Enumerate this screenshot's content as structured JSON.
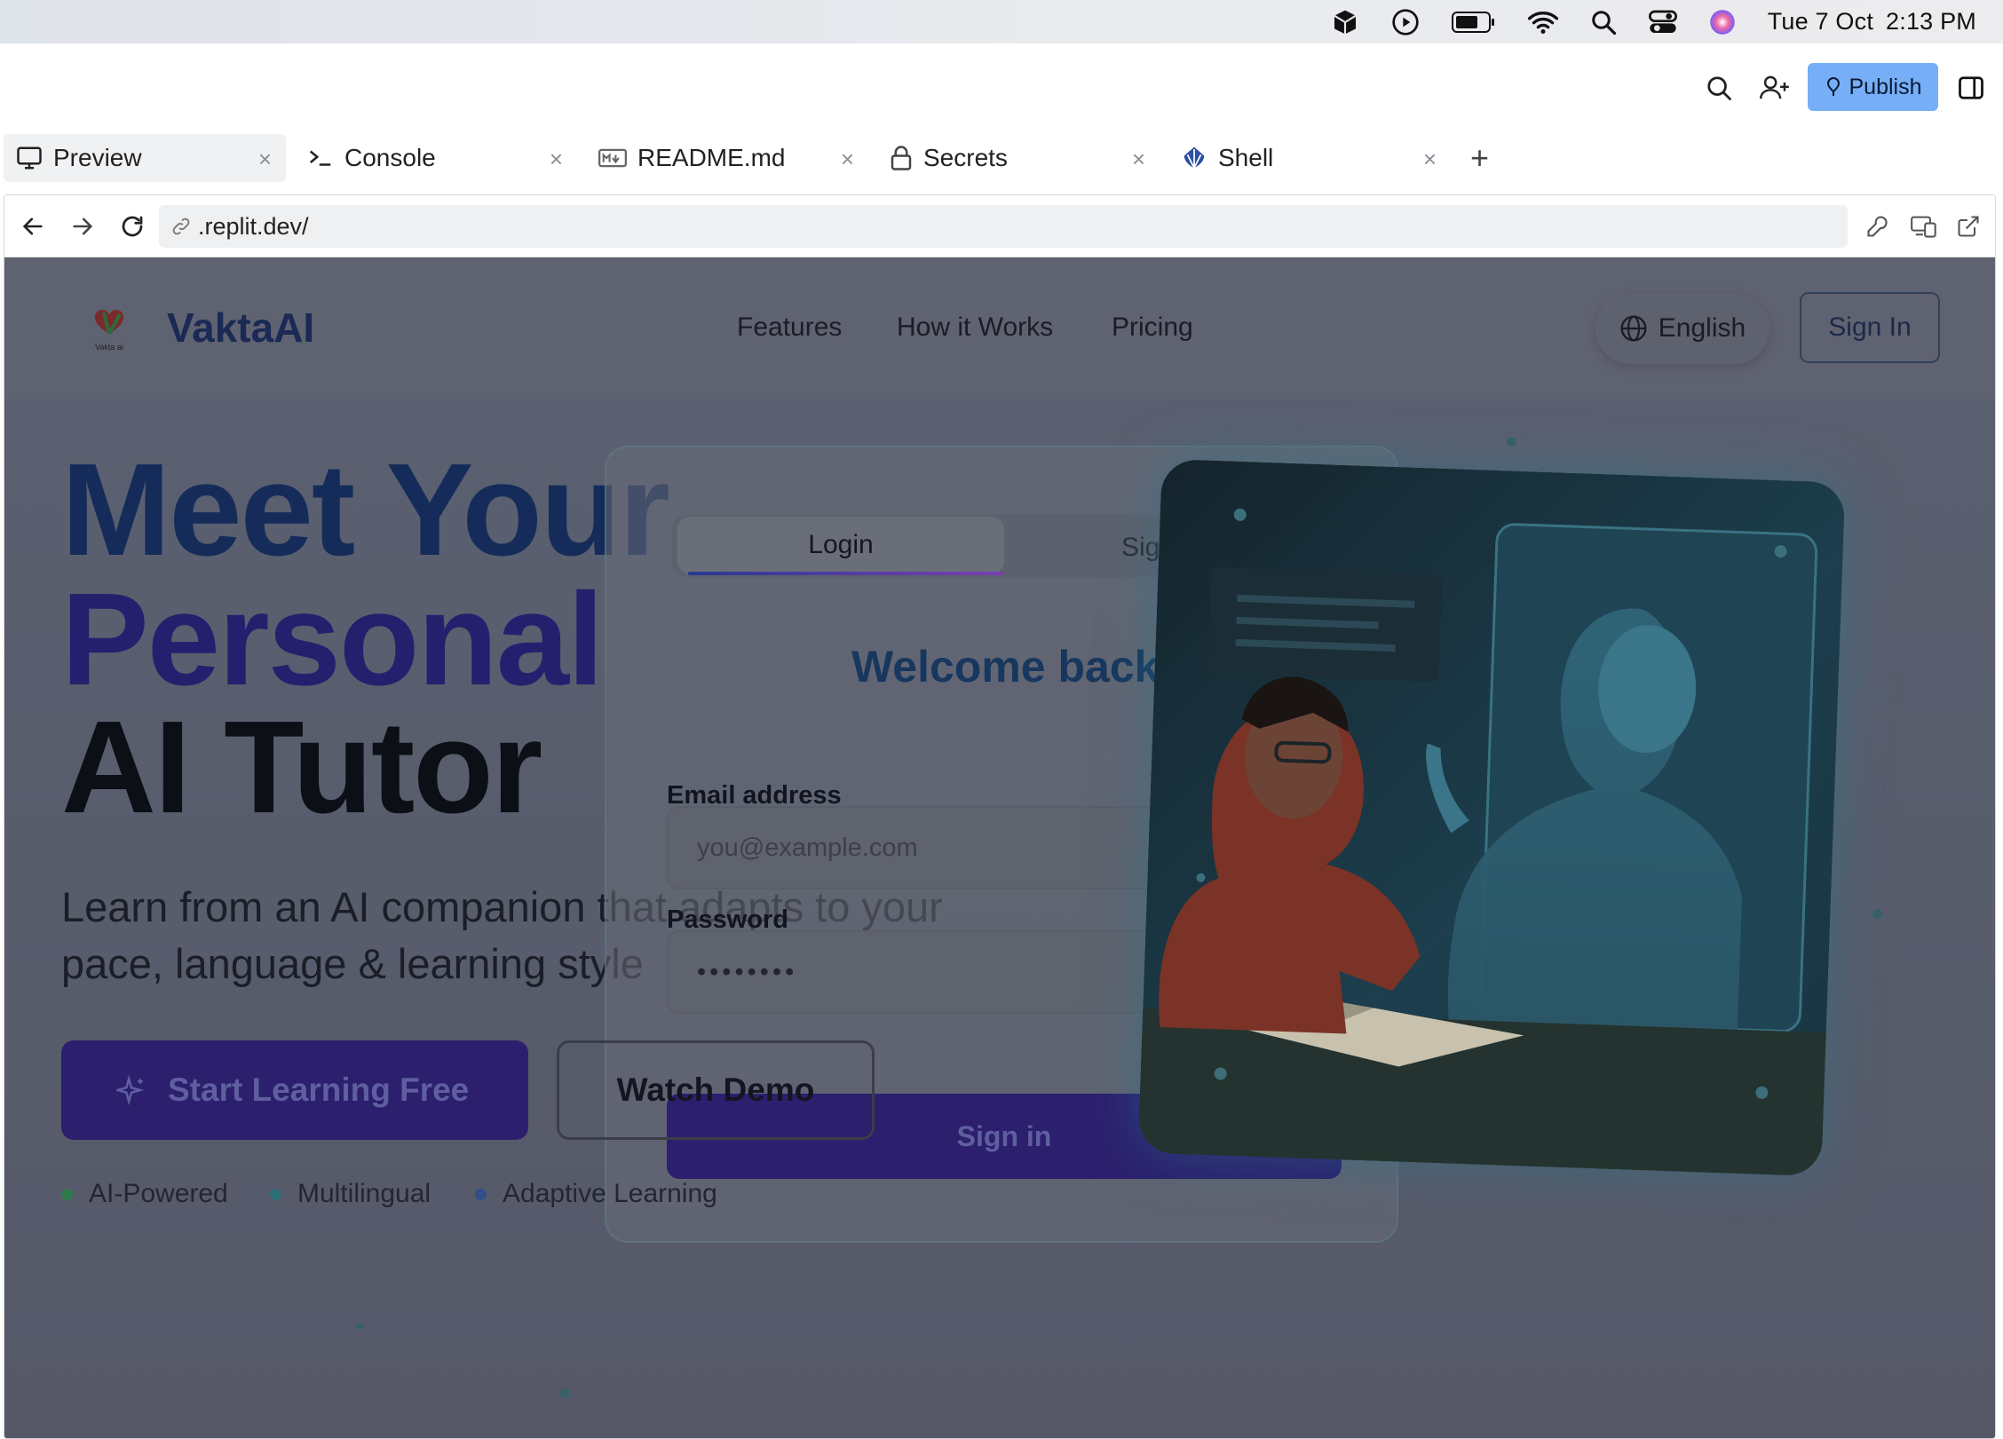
{
  "menubar": {
    "date": "Tue 7 Oct",
    "time": "2:13 PM",
    "icons": [
      "package-icon",
      "play-icon",
      "battery-icon",
      "wifi-icon",
      "spotlight-icon",
      "control-center-icon",
      "siri-icon"
    ]
  },
  "topbar": {
    "publish_label": "Publish",
    "icons": [
      "search-icon",
      "invite-icon",
      "pin-icon",
      "split-pane-icon"
    ]
  },
  "tabs": [
    {
      "label": "Preview",
      "icon": "monitor-icon",
      "active": true
    },
    {
      "label": "Console",
      "icon": "terminal-icon",
      "active": false
    },
    {
      "label": "README.md",
      "icon": "markdown-icon",
      "active": false
    },
    {
      "label": "Secrets",
      "icon": "lock-icon",
      "active": false
    },
    {
      "label": "Shell",
      "icon": "shell-icon",
      "active": false
    }
  ],
  "browser": {
    "url": ".replit.dev/",
    "icons": [
      "back-icon",
      "forward-icon",
      "reload-icon",
      "link-icon",
      "wrench-icon",
      "devices-icon",
      "external-link-icon"
    ]
  },
  "site": {
    "brand": "VaktaAI",
    "logo_text": "Vakta ai",
    "nav": [
      "Features",
      "How it Works",
      "Pricing"
    ],
    "language": "English",
    "sign_in": "Sign In",
    "hero": {
      "line1": "Meet Your",
      "line2": "Personal",
      "line3": "AI Tutor",
      "subtitle": "Learn from an AI companion that adapts to your pace, language & learning style",
      "cta_primary": "Start Learning Free",
      "cta_secondary": "Watch Demo",
      "features": [
        {
          "label": "AI-Powered",
          "color": "#2f7a4a"
        },
        {
          "label": "Multilingual",
          "color": "#2f6e78"
        },
        {
          "label": "Adaptive Learning",
          "color": "#324f8a"
        }
      ]
    },
    "login_modal": {
      "tab_login": "Login",
      "tab_signup": "Sig",
      "welcome": "Welcome back",
      "email_label": "Email address",
      "email_placeholder": "you@example.com",
      "password_label": "Password",
      "password_value": "••••••••",
      "submit": "Sign in"
    }
  },
  "colors": {
    "publish_bg": "#76aef7",
    "brand_navy": "#1a2a55",
    "hero_line1": "#152c5a",
    "hero_line2": "#24206e",
    "overlay": "#5b5f6b"
  }
}
